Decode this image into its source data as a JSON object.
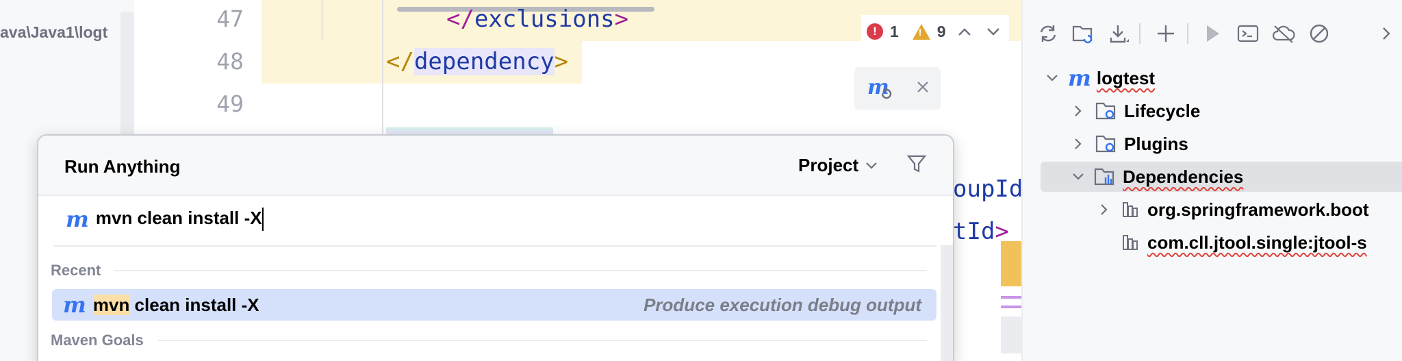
{
  "left_panel": {
    "path_fragment": "ava\\Java1\\logt"
  },
  "editor": {
    "line_numbers": [
      "47",
      "48",
      "49"
    ],
    "code": {
      "line47_open": "</",
      "line47_tag": "exclusions",
      "line47_close": ">",
      "line48_open": "</",
      "line48_tag": "dependency",
      "line48_close": ">",
      "frag1": "oupId",
      "frag2_tag": "tId",
      "frag2_close": ">"
    },
    "inspections": {
      "errors": "1",
      "warnings": "9"
    }
  },
  "maven_panel": {
    "project": "logtest",
    "items": [
      {
        "label": "Lifecycle"
      },
      {
        "label": "Plugins"
      },
      {
        "label": "Dependencies"
      }
    ],
    "dependencies": [
      {
        "label": "org.springframework.boot"
      },
      {
        "label": "com.cll.jtool.single:jtool-s"
      }
    ]
  },
  "run_anything": {
    "title": "Run Anything",
    "scope": "Project",
    "input_value": "mvn clean install -X",
    "sections": {
      "recent": "Recent",
      "maven_goals": "Maven Goals"
    },
    "recent_item": {
      "match": "mvn",
      "rest": " clean install -X",
      "hint": "Produce execution debug output"
    }
  },
  "colors": {
    "accent_blue": "#3574f0",
    "selected_row": "#d5e1fb",
    "match_highlight": "#fcdfa6",
    "error": "#db3b4b",
    "warning": "#e3a72f"
  }
}
